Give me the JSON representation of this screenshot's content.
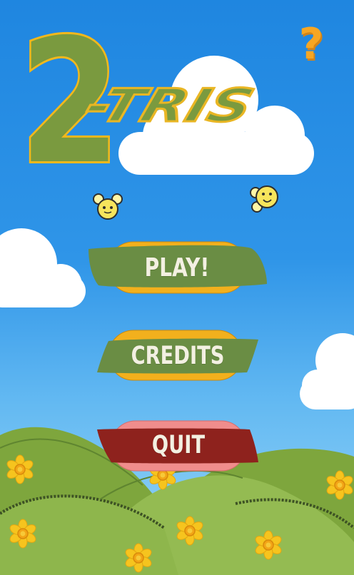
{
  "game": {
    "title_number": "2",
    "title_word": "-TRIS"
  },
  "menu": {
    "play_label": "PLAY!",
    "credits_label": "CREDITS",
    "quit_label": "QUIT",
    "help_label": "?"
  },
  "colors": {
    "sky_top": "#1f86e0",
    "sky_bottom": "#9ad6f7",
    "button_green": "#6a8d44",
    "button_yellow": "#f2b01d",
    "quit_red": "#8e221d",
    "quit_pink": "#f08d8c",
    "hill_green": "#8cb34a",
    "flower_yellow": "#f7d22a",
    "help_orange": "#f6a623"
  },
  "icons": [
    "help-question-icon",
    "bee-character-icon",
    "smiley-character-icon",
    "daffodil-flower-icon",
    "cloud-icon"
  ]
}
